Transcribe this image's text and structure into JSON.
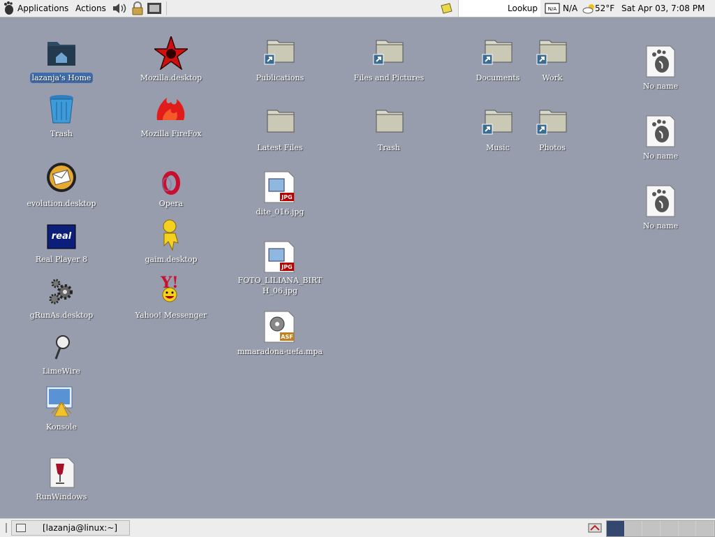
{
  "top_panel": {
    "applications": "Applications",
    "actions": "Actions",
    "lookup": "Lookup",
    "na_icon_text": "N/A",
    "weather_na": "N/A",
    "temperature": "52°F",
    "clock": "Sat Apr 03,  7:08 PM"
  },
  "bottom_panel": {
    "task": "[lazanja@linux:~]",
    "workspaces": 6
  },
  "desktop": {
    "col1": [
      {
        "label": "lazanja's Home",
        "icon": "home-folder-icon"
      },
      {
        "label": "Trash",
        "icon": "trash-icon"
      },
      {
        "label": "evolution.desktop",
        "icon": "evolution-icon"
      },
      {
        "label": "Real Player 8",
        "icon": "realplayer-icon"
      },
      {
        "label": "gRunAs.desktop",
        "icon": "gears-icon"
      },
      {
        "label": "LimeWire",
        "icon": "limewire-icon"
      },
      {
        "label": "Konsole",
        "icon": "konsole-icon"
      },
      {
        "label": "RunWindows",
        "icon": "wine-icon"
      }
    ],
    "col2": [
      {
        "label": "Mozilla.desktop",
        "icon": "mozilla-icon"
      },
      {
        "label": "Mozilla FireFox",
        "icon": "firefox-icon"
      },
      {
        "label": "Opera",
        "icon": "opera-icon"
      },
      {
        "label": "gaim.desktop",
        "icon": "gaim-icon"
      },
      {
        "label": "Yahoo! Messenger",
        "icon": "yahoo-icon"
      }
    ],
    "col3": [
      {
        "label": "Publications",
        "icon": "folder-link-icon"
      },
      {
        "label": "Latest Files",
        "icon": "folder-icon"
      },
      {
        "label": "dite_016.jpg",
        "icon": "jpg-file-icon"
      },
      {
        "label": "FOTO_LILIANA_BIRTH_06.jpg",
        "icon": "jpg-file-icon"
      },
      {
        "label": "mmaradona-uefa.mpa",
        "icon": "asf-file-icon"
      }
    ],
    "col4": [
      {
        "label": "Files and Pictures",
        "icon": "folder-link-icon"
      },
      {
        "label": "Trash",
        "icon": "folder-icon"
      }
    ],
    "col5": [
      {
        "label": "Documents",
        "icon": "folder-link-icon"
      },
      {
        "label": "Music",
        "icon": "folder-link-icon"
      }
    ],
    "col6": [
      {
        "label": "Work",
        "icon": "folder-link-icon"
      },
      {
        "label": "Photos",
        "icon": "folder-link-icon"
      }
    ],
    "col7": [
      {
        "label": "No name",
        "icon": "gnome-foot-icon"
      },
      {
        "label": "No name",
        "icon": "gnome-foot-icon"
      },
      {
        "label": "No name",
        "icon": "gnome-foot-icon"
      }
    ]
  },
  "colors": {
    "desktop_bg": "#979dac",
    "selection": "#3e6baa",
    "active_workspace": "#34476e"
  }
}
